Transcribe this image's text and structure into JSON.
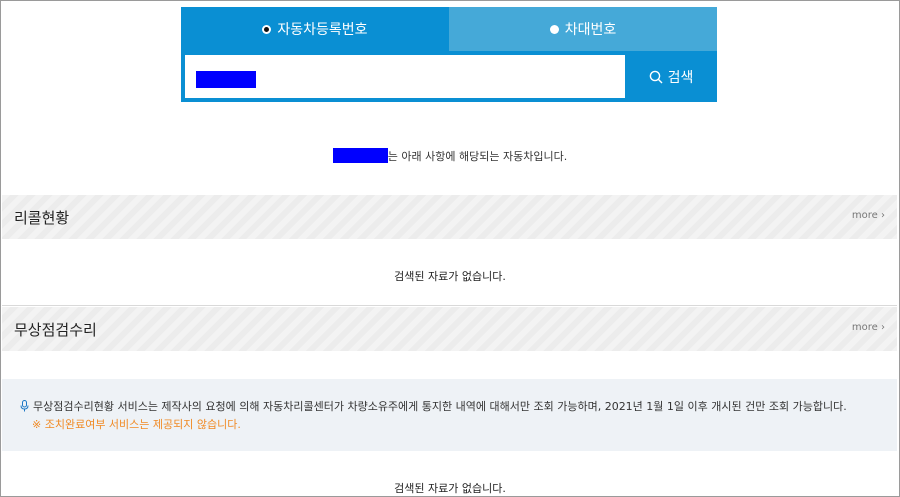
{
  "search": {
    "tabs": [
      {
        "label": "자동차등록번호",
        "selected": true
      },
      {
        "label": "차대번호",
        "selected": false
      }
    ],
    "input_value": "",
    "button_label": "검색",
    "button_icon": "search-icon"
  },
  "result": {
    "suffix_text": "는 아래 사항에 해당되는 자동차입니다."
  },
  "sections": [
    {
      "title": "리콜현황",
      "more_label": "more ›",
      "empty_text": "검색된 자료가 없습니다."
    },
    {
      "title": "무상점검수리",
      "more_label": "more ›",
      "empty_text": "검색된 자료가 없습니다."
    }
  ],
  "notice": {
    "icon": "microphone-icon",
    "text": "무상점검수리현황 서비스는 제작사의 요청에 의해 자동차리콜센터가 차량소유주에게 통지한 내역에 대해서만 조회 가능하며, 2021년 1월 1일 이후 개시된 건만 조회 가능합니다.",
    "warning": "※ 조치완료여부 서비스는 제공되지 않습니다."
  },
  "colors": {
    "primary": "#0a8fd3",
    "tab_inactive": "#45a9d8",
    "redaction": "#0000ff",
    "warning": "#f08a24",
    "notice_bg": "#eef2f6"
  }
}
